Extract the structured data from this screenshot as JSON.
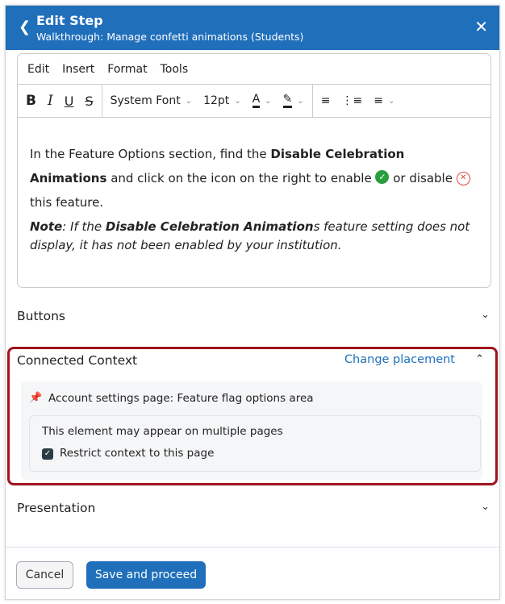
{
  "header": {
    "back_icon": "chevron-left-icon",
    "title": "Edit Step",
    "subtitle": "Walkthrough: Manage confetti animations (Students)",
    "close_icon": "close-icon"
  },
  "editor": {
    "menu": [
      "Edit",
      "Insert",
      "Format",
      "Tools"
    ],
    "toolbar": {
      "bold": "B",
      "italic": "I",
      "underline": "U",
      "strike": "S",
      "font": "System Font",
      "size": "12pt",
      "text_color": "A"
    },
    "content": {
      "p1a": "In the Feature Options section, find the ",
      "p1b": "Disable Celebration Animations",
      "p1c": "and click on the icon on the right to enable ",
      "p1d": " or disable ",
      "p1e": " this feature.",
      "note_label": "Note",
      "note_a": ": If the ",
      "note_b": "Disable Celebration Animation",
      "note_c": "s feature setting does not display, it has not been enabled by your institution."
    }
  },
  "sections": {
    "buttons": "Buttons",
    "presentation": "Presentation"
  },
  "connected": {
    "title": "Connected Context",
    "change": "Change placement",
    "location": "Account settings page: Feature flag options area",
    "multi": "This element may appear on multiple pages",
    "restrict": "Restrict context to this page",
    "restrict_checked": true
  },
  "footer": {
    "cancel": "Cancel",
    "save": "Save and proceed"
  },
  "colors": {
    "header": "#1f6fbb",
    "highlight": "#a0141e"
  }
}
